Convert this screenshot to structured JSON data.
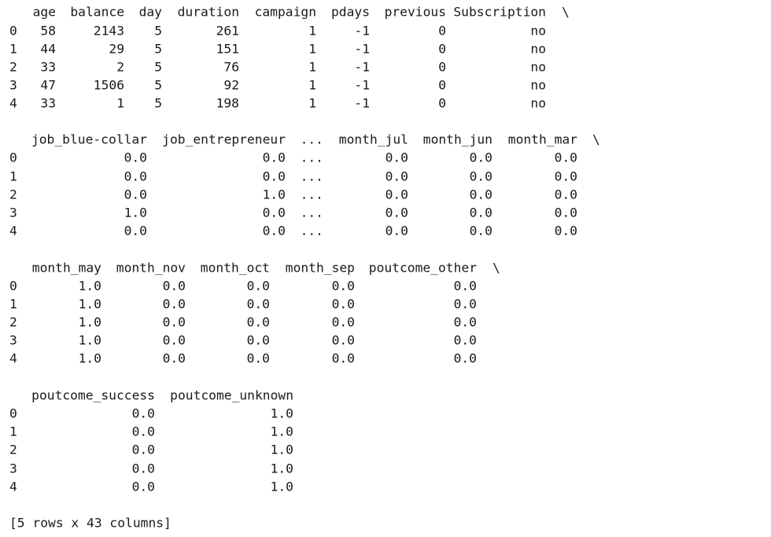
{
  "blocks": [
    {
      "header": [
        "age",
        "balance",
        "day",
        "duration",
        "campaign",
        "pdays",
        "previous",
        "Subscription"
      ],
      "continuation": "\\",
      "index": [
        "0",
        "1",
        "2",
        "3",
        "4"
      ],
      "rows": [
        [
          "58",
          "2143",
          "5",
          "261",
          "1",
          "-1",
          "0",
          "no"
        ],
        [
          "44",
          "29",
          "5",
          "151",
          "1",
          "-1",
          "0",
          "no"
        ],
        [
          "33",
          "2",
          "5",
          "76",
          "1",
          "-1",
          "0",
          "no"
        ],
        [
          "47",
          "1506",
          "5",
          "92",
          "1",
          "-1",
          "0",
          "no"
        ],
        [
          "33",
          "1",
          "5",
          "198",
          "1",
          "-1",
          "0",
          "no"
        ]
      ]
    },
    {
      "header": [
        "job_blue-collar",
        "job_entrepreneur",
        "...",
        "month_jul",
        "month_jun",
        "month_mar"
      ],
      "continuation": "\\",
      "index": [
        "0",
        "1",
        "2",
        "3",
        "4"
      ],
      "rows": [
        [
          "0.0",
          "0.0",
          "...",
          "0.0",
          "0.0",
          "0.0"
        ],
        [
          "0.0",
          "0.0",
          "...",
          "0.0",
          "0.0",
          "0.0"
        ],
        [
          "0.0",
          "1.0",
          "...",
          "0.0",
          "0.0",
          "0.0"
        ],
        [
          "1.0",
          "0.0",
          "...",
          "0.0",
          "0.0",
          "0.0"
        ],
        [
          "0.0",
          "0.0",
          "...",
          "0.0",
          "0.0",
          "0.0"
        ]
      ]
    },
    {
      "header": [
        "month_may",
        "month_nov",
        "month_oct",
        "month_sep",
        "poutcome_other"
      ],
      "continuation": "\\",
      "index": [
        "0",
        "1",
        "2",
        "3",
        "4"
      ],
      "rows": [
        [
          "1.0",
          "0.0",
          "0.0",
          "0.0",
          "0.0"
        ],
        [
          "1.0",
          "0.0",
          "0.0",
          "0.0",
          "0.0"
        ],
        [
          "1.0",
          "0.0",
          "0.0",
          "0.0",
          "0.0"
        ],
        [
          "1.0",
          "0.0",
          "0.0",
          "0.0",
          "0.0"
        ],
        [
          "1.0",
          "0.0",
          "0.0",
          "0.0",
          "0.0"
        ]
      ]
    },
    {
      "header": [
        "poutcome_success",
        "poutcome_unknown"
      ],
      "continuation": "",
      "index": [
        "0",
        "1",
        "2",
        "3",
        "4"
      ],
      "rows": [
        [
          "0.0",
          "1.0"
        ],
        [
          "0.0",
          "1.0"
        ],
        [
          "0.0",
          "1.0"
        ],
        [
          "0.0",
          "1.0"
        ],
        [
          "0.0",
          "1.0"
        ]
      ]
    }
  ],
  "footer": "[5 rows x 43 columns]"
}
